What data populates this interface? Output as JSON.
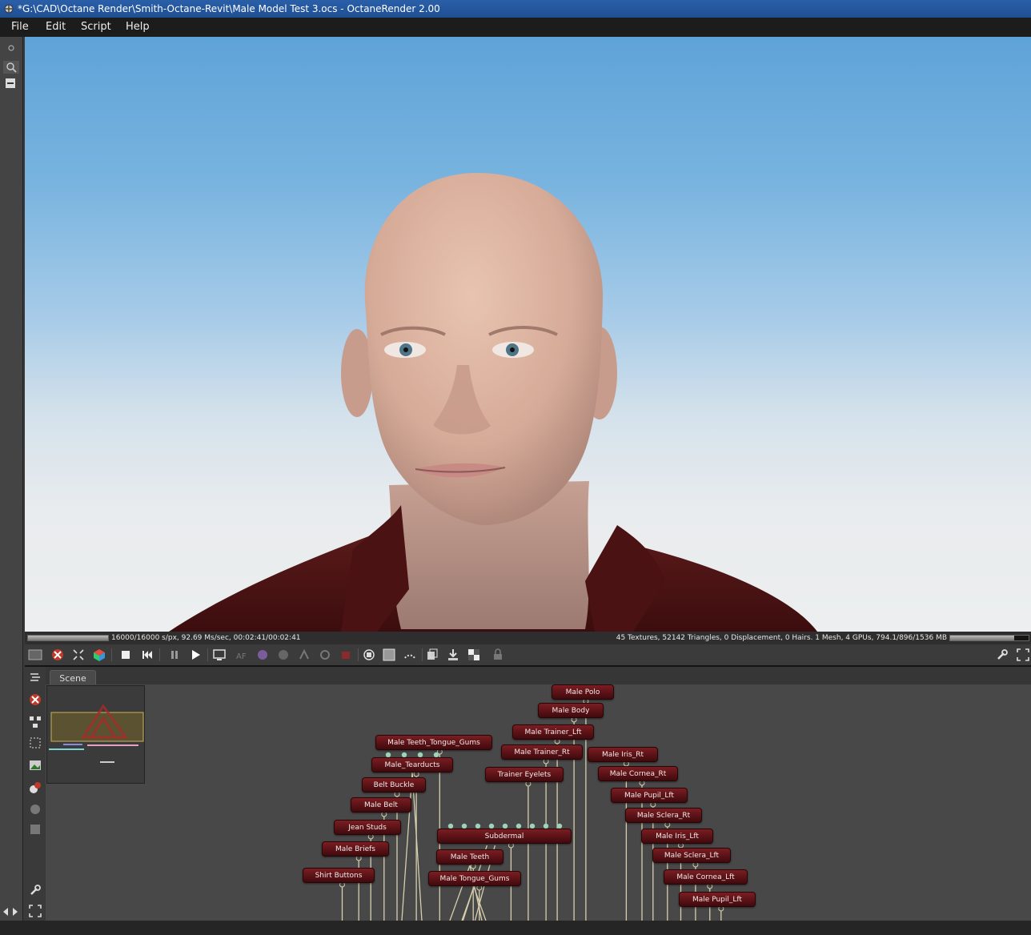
{
  "window": {
    "title": "*G:\\CAD\\Octane Render\\Smith-Octane-Revit\\Male Model Test 3.ocs - OctaneRender 2.00"
  },
  "menu": [
    "File",
    "Edit",
    "Script",
    "Help"
  ],
  "status": {
    "render_stats": "16000/16000 s/px, 92.69 Ms/sec, 00:02:41/00:02:41",
    "scene_stats": "45 Textures, 52142 Triangles, 0 Displacement, 0 Hairs. 1 Mesh, 4 GPUs, 794.1/896/1536 MB",
    "render_progress": 1.0,
    "memory_progress": 0.82
  },
  "tabs": {
    "scene": "Scene"
  },
  "nodes": [
    "Male Polo",
    "Male Body",
    "Male Trainer_Lft",
    "Male Trainer_Rt",
    "Male Iris_Rt",
    "Trainer Eyelets",
    "Male Cornea_Rt",
    "Male Pupil_Lft",
    "Male Sclera_Rt",
    "Male Iris_Lft",
    "Male Sclera_Lft",
    "Male Cornea_Lft",
    "Male Pupil_Lft",
    "Male Teeth_Tongue_Gums",
    "Male_Tearducts",
    "Belt Buckle",
    "Male Belt",
    "Jean Studs",
    "Male Briefs",
    "Shirt Buttons",
    "Subdermal",
    "Male Teeth",
    "Male Tongue_Gums"
  ],
  "colors": {
    "node_fill": "#5a1216",
    "wire": "#d8cfae",
    "pin": "#9fd3b8",
    "sky_top": "#5ea3d8",
    "sky_horizon": "#eceeef"
  }
}
